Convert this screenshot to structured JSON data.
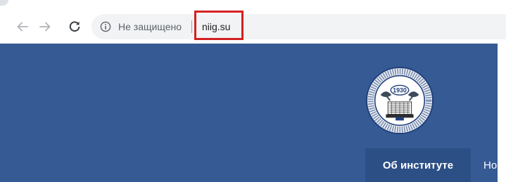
{
  "browser": {
    "nav": {
      "back_icon": "arrow-left-icon",
      "forward_icon": "arrow-right-icon",
      "reload_icon": "reload-icon"
    },
    "address_bar": {
      "security_icon": "info-icon",
      "security_label": "Не защищено",
      "url": "niig.su"
    },
    "highlight_color": "#d42020"
  },
  "site": {
    "header_color": "#355a94",
    "logo": {
      "year": "1930",
      "ring_text": "НОВОСИБИРСКИЙ НАУЧНО-ИССЛЕДОВАТЕЛЬСКИЙ ИНСТИТУТ ГИГИЕНЫ"
    },
    "nav": {
      "items": [
        {
          "label": "Об институте"
        },
        {
          "label": "Нов"
        }
      ]
    }
  }
}
